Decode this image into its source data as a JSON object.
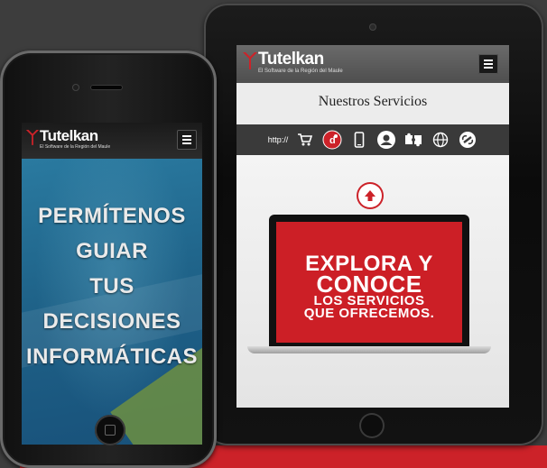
{
  "brand": {
    "name": "Tutelkan",
    "tagline": "El Software de la Región del Maule",
    "accent_color": "#cc2229"
  },
  "tablet": {
    "section_title": "Nuestros Servicios",
    "service_icons": [
      {
        "name": "http-icon",
        "label": "http://"
      },
      {
        "name": "cart-icon"
      },
      {
        "name": "d-badge-icon",
        "label": "d"
      },
      {
        "name": "mobile-icon"
      },
      {
        "name": "user-icon"
      },
      {
        "name": "puzzle-icon"
      },
      {
        "name": "globe-icon"
      },
      {
        "name": "link-icon"
      }
    ],
    "laptop_text": {
      "line1": "EXPLORA Y",
      "line2": "CONOCE",
      "line3": "LOS SERVICIOS",
      "line4": "QUE OFRECEMOS."
    }
  },
  "phone": {
    "hero_lines": [
      "PERMÍTENOS",
      "GUIAR",
      "TUS",
      "DECISIONES",
      "INFORMÁTICAS"
    ]
  }
}
